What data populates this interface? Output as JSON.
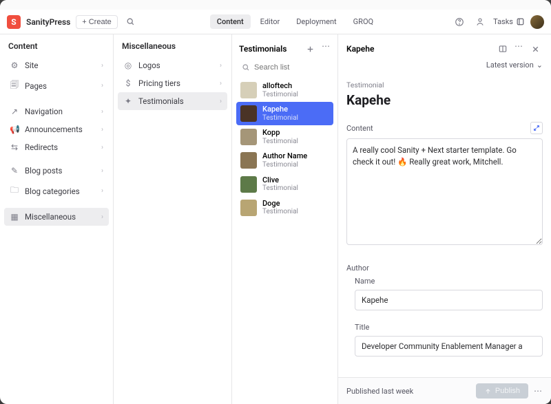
{
  "brand": "SanityPress",
  "logo_letter": "S",
  "create_label": "Create",
  "nav": [
    {
      "label": "Content",
      "active": true
    },
    {
      "label": "Editor",
      "active": false
    },
    {
      "label": "Deployment",
      "active": false
    },
    {
      "label": "GROQ",
      "active": false
    }
  ],
  "tasks_label": "Tasks",
  "col1": {
    "title": "Content",
    "items": [
      {
        "icon": "⚙",
        "label": "Site"
      },
      {
        "icon": "🗐",
        "label": "Pages"
      },
      {
        "divider": true
      },
      {
        "icon": "↗",
        "label": "Navigation"
      },
      {
        "icon": "📢",
        "label": "Announcements"
      },
      {
        "icon": "⇆",
        "label": "Redirects"
      },
      {
        "divider": true
      },
      {
        "icon": "✎",
        "label": "Blog posts"
      },
      {
        "icon": "🗀",
        "label": "Blog categories"
      },
      {
        "divider": true
      },
      {
        "icon": "▦",
        "label": "Miscellaneous",
        "active": true
      }
    ]
  },
  "col2": {
    "title": "Miscellaneous",
    "items": [
      {
        "icon": "◎",
        "label": "Logos"
      },
      {
        "icon": "$",
        "label": "Pricing tiers"
      },
      {
        "icon": "✦",
        "label": "Testimonials",
        "active": true
      }
    ]
  },
  "col3": {
    "title": "Testimonials",
    "search_placeholder": "Search list",
    "items": [
      {
        "name": "alloftech",
        "sub": "Testimonial"
      },
      {
        "name": "Kapehe",
        "sub": "Testimonial",
        "selected": true
      },
      {
        "name": "Kopp",
        "sub": "Testimonial"
      },
      {
        "name": "Author Name",
        "sub": "Testimonial"
      },
      {
        "name": "Clive",
        "sub": "Testimonial"
      },
      {
        "name": "Doge",
        "sub": "Testimonial"
      }
    ]
  },
  "doc": {
    "header_title": "Kapehe",
    "version_label": "Latest version",
    "eyebrow": "Testimonial",
    "title": "Kapehe",
    "content_label": "Content",
    "content_value": "A really cool Sanity + Next starter template. Go check it out! 🔥 Really great work, Mitchell.",
    "author_label": "Author",
    "name_label": "Name",
    "name_value": "Kapehe",
    "title_label": "Title",
    "title_value": "Developer Community Enablement Manager a",
    "published_status": "Published last week",
    "publish_button": "Publish"
  },
  "thumb_colors": [
    "#d6cfb8",
    "#4a3326",
    "#a59678",
    "#8a7553",
    "#5d7a48",
    "#b8a573"
  ]
}
